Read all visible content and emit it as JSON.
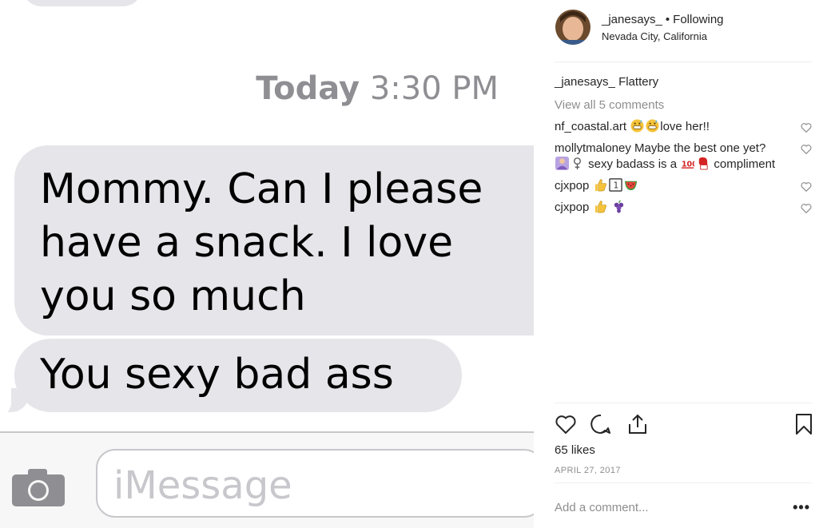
{
  "post_image": {
    "timestamp_day": "Today",
    "timestamp_time": "3:30 PM",
    "message_1_lines": [
      "Mommy. Can I please",
      "have a snack. I love",
      "you so much"
    ],
    "message_2": "You sexy bad ass",
    "input_placeholder": "iMessage"
  },
  "header": {
    "username": "_janesays_",
    "separator": "•",
    "follow_label": "Following",
    "location": "Nevada City, California"
  },
  "caption": {
    "username": "_janesays_",
    "text": "Flattery"
  },
  "view_all_label": "View all 5 comments",
  "comments": [
    {
      "username": "nf_coastal.art",
      "emojis": [
        "grinning-sweat-emoji",
        "grinning-sweat-emoji"
      ],
      "text": "love her!!"
    },
    {
      "username": "mollytmaloney",
      "text_1": "Maybe the best one yet?",
      "text_2": "sexy badass is a",
      "text_3": "compliment"
    },
    {
      "username": "cjxpop",
      "emojis": [
        "thumbs-up-emoji",
        "keycap-1-emoji",
        "watermelon-emoji"
      ]
    },
    {
      "username": "cjxpop",
      "emojis": [
        "thumbs-up-emoji",
        "grapes-emoji"
      ]
    }
  ],
  "likes": "65 likes",
  "date": "APRIL 27, 2017",
  "add_comment_placeholder": "Add a comment...",
  "more_label": "•••",
  "colors": {
    "bubble": "#e5e5ea",
    "timestamp": "#8e8e93",
    "muted_text": "#8e8e8e",
    "text": "#262626",
    "divider": "#efefef"
  },
  "icons": {
    "like": "heart-icon",
    "comment": "comment-icon",
    "share": "share-icon",
    "save": "bookmark-icon",
    "camera": "camera-icon"
  }
}
